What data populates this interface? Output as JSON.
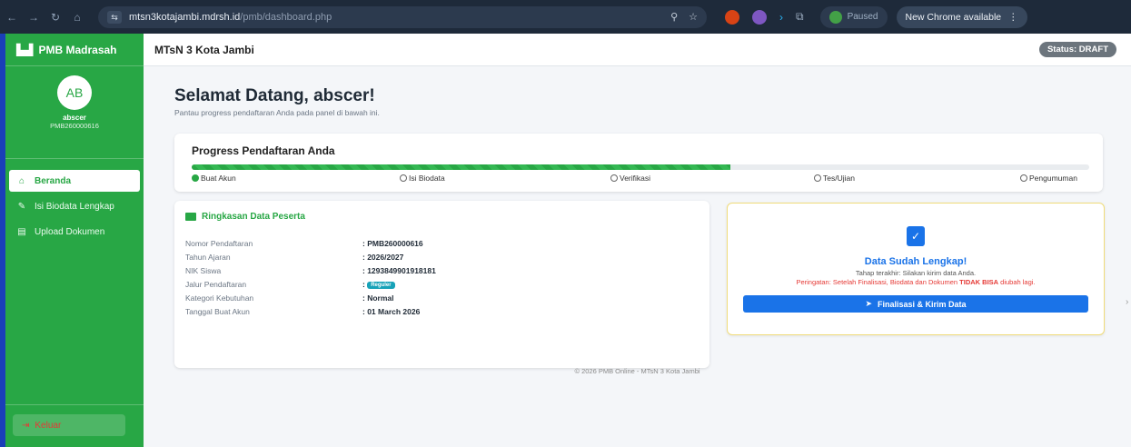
{
  "browser": {
    "url_host": "mtsn3kotajambi.mdrsh.id",
    "url_path": "/pmb/dashboard.php",
    "paused_label": "Paused",
    "update_label": "New Chrome available"
  },
  "sidebar": {
    "brand": "PMB Madrasah",
    "avatar_initials": "AB",
    "user_name": "abscer",
    "user_id": "PMB260000616",
    "items": [
      {
        "label": "Beranda",
        "icon": "home-icon",
        "active": true
      },
      {
        "label": "Isi Biodata Lengkap",
        "icon": "user-edit-icon",
        "active": false
      },
      {
        "label": "Upload Dokumen",
        "icon": "file-icon",
        "active": false
      }
    ],
    "logout_label": "Keluar"
  },
  "header": {
    "title": "MTsN 3 Kota Jambi",
    "status": "Status: DRAFT"
  },
  "welcome": {
    "title": "Selamat Datang, abscer!",
    "subtitle": "Pantau progress pendaftaran Anda pada panel di bawah ini."
  },
  "progress": {
    "title": "Progress Pendaftaran Anda",
    "fill": 0.6,
    "steps": [
      {
        "label": "Buat Akun",
        "done": true
      },
      {
        "label": "Isi Biodata",
        "done": false
      },
      {
        "label": "Verifikasi",
        "done": false
      },
      {
        "label": "Tes/Ujian",
        "done": false
      },
      {
        "label": "Pengumuman",
        "done": false
      }
    ]
  },
  "summary": {
    "title": "Ringkasan Data Peserta",
    "rows": [
      {
        "label": "Nomor Pendaftaran",
        "value": ": PMB260000616"
      },
      {
        "label": "Tahun Ajaran",
        "value": ": 2026/2027"
      },
      {
        "label": "NIK Siswa",
        "value": ": 1293849901918181"
      },
      {
        "label": "Jalur Pendaftaran",
        "value": ": ",
        "badge": "Reguler"
      },
      {
        "label": "Kategori Kebutuhan",
        "value": ": Normal"
      },
      {
        "label": "Tanggal Buat Akun",
        "value": ": 01 March 2026"
      }
    ]
  },
  "complete": {
    "title": "Data Sudah Lengkap!",
    "line1": "Tahap terakhir: Silakan kirim data Anda.",
    "line2_pre": "Peringatan: Setelah Finalisasi, Biodata dan Dokumen ",
    "line2_strong": "TIDAK BISA",
    "line2_post": " diubah lagi.",
    "button": "Finalisasi & Kirim Data"
  },
  "footer": "© 2026 PMB Online - MTsN 3 Kota Jambi",
  "colors": {
    "primary_green": "#28a745",
    "primary_blue": "#1a73e8",
    "danger": "#e53935"
  }
}
